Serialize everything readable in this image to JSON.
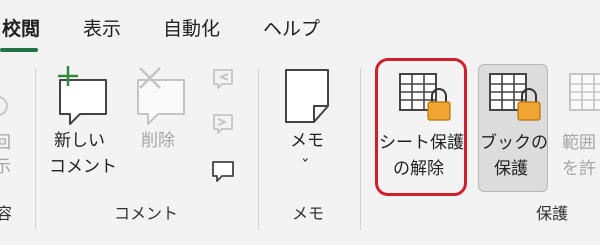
{
  "tabs": [
    {
      "label": "校閲",
      "active": true
    },
    {
      "label": "表示",
      "active": false
    },
    {
      "label": "自動化",
      "active": false
    },
    {
      "label": "ヘルプ",
      "active": false
    }
  ],
  "partial_group": {
    "button_line1": "回",
    "button_line2": "示",
    "group_label": "容"
  },
  "comment_group": {
    "new_comment_line1": "新しい",
    "new_comment_line2": "コメント",
    "delete_label": "削除",
    "group_label": "コメント"
  },
  "memo_group": {
    "memo_label": "メモ",
    "chevron": "ˇ",
    "group_label": "メモ"
  },
  "protect_group": {
    "unprotect_sheet_line1": "シート保護",
    "unprotect_sheet_line2": "の解除",
    "protect_workbook_line1": "ブックの",
    "protect_workbook_line2": "保護",
    "allow_range_line1": "範囲",
    "allow_range_line2": "を許",
    "group_label": "保護"
  },
  "colors": {
    "accent_green": "#217346",
    "highlight_red": "#d21f2e",
    "lock_orange": "#f0a531"
  }
}
